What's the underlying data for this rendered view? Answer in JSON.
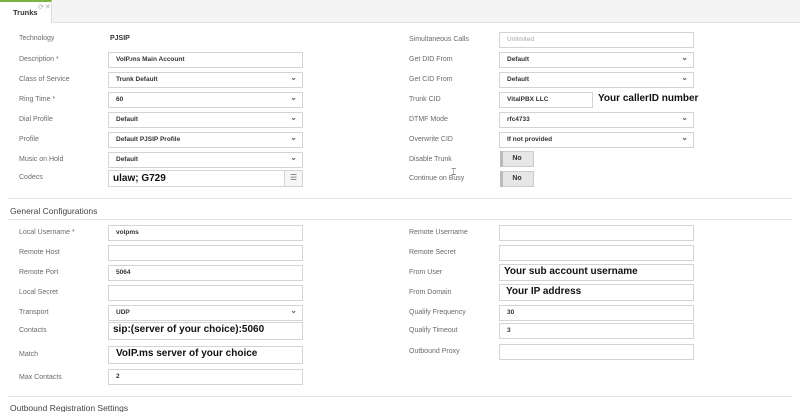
{
  "tab": {
    "label": "Trunks",
    "icons": "⟳✕"
  },
  "left": [
    {
      "label": "Technology",
      "value": "PJSIP",
      "kind": "static"
    },
    {
      "label": "Description *",
      "value": "VoIP.ms Main Account",
      "kind": "input"
    },
    {
      "label": "Class of Service",
      "value": "Trunk Default",
      "kind": "select"
    },
    {
      "label": "Ring Time *",
      "value": "60",
      "kind": "select"
    },
    {
      "label": "Dial Profile",
      "value": "Default",
      "kind": "select"
    },
    {
      "label": "Profile",
      "value": "Default PJSIP Profile",
      "kind": "select"
    },
    {
      "label": "Music on Hold",
      "value": "Default",
      "kind": "select"
    },
    {
      "label": "Codecs",
      "value": "ulaw; G729",
      "kind": "codecs"
    }
  ],
  "right": [
    {
      "label": "Simultaneous Calls",
      "value": "Unlimited",
      "kind": "input-muted"
    },
    {
      "label": "Get DID From",
      "value": "Default",
      "kind": "select"
    },
    {
      "label": "Get CID From",
      "value": "Default",
      "kind": "select"
    },
    {
      "label": "Trunk CID",
      "value": "VitalPBX LLC",
      "kind": "cid"
    },
    {
      "label": "DTMF Mode",
      "value": "rfc4733",
      "kind": "select"
    },
    {
      "label": "Overwrite CID",
      "value": "If not provided",
      "kind": "select"
    },
    {
      "label": "Disable Trunk",
      "value": "No",
      "kind": "toggle"
    },
    {
      "label": "Continue on Busy",
      "value": "No",
      "kind": "toggle"
    }
  ],
  "annotations": {
    "caller_id": "Your callerID number",
    "sub_account": "Your sub account username",
    "ip_address": "Your IP address",
    "contacts": "sip:(server of your choice):5060",
    "match": "VoIP.ms server of your choice"
  },
  "general": {
    "title": "General Configurations",
    "left": [
      {
        "label": "Local Username *",
        "value": "voipms",
        "kind": "input"
      },
      {
        "label": "Remote Host",
        "value": "",
        "kind": "input"
      },
      {
        "label": "Remote Port",
        "value": "5064",
        "kind": "input"
      },
      {
        "label": "Local Secret",
        "value": "",
        "kind": "input"
      },
      {
        "label": "Transport",
        "value": "UDP",
        "kind": "select"
      },
      {
        "label": "Contacts",
        "value": "",
        "kind": "input"
      },
      {
        "label": "Match",
        "value": "",
        "kind": "input"
      },
      {
        "label": "Max Contacts",
        "value": "2",
        "kind": "input"
      }
    ],
    "right": [
      {
        "label": "Remote Username",
        "value": "",
        "kind": "input"
      },
      {
        "label": "Remote Secret",
        "value": "",
        "kind": "input"
      },
      {
        "label": "From User",
        "value": "",
        "kind": "input"
      },
      {
        "label": "From Domain",
        "value": "",
        "kind": "input"
      },
      {
        "label": "Qualify Frequency",
        "value": "30",
        "kind": "input"
      },
      {
        "label": "Qualify Timeout",
        "value": "3",
        "kind": "input"
      },
      {
        "label": "Outbound Proxy",
        "value": "",
        "kind": "input"
      }
    ]
  },
  "outbound": {
    "title": "Outbound Registration Settings"
  }
}
